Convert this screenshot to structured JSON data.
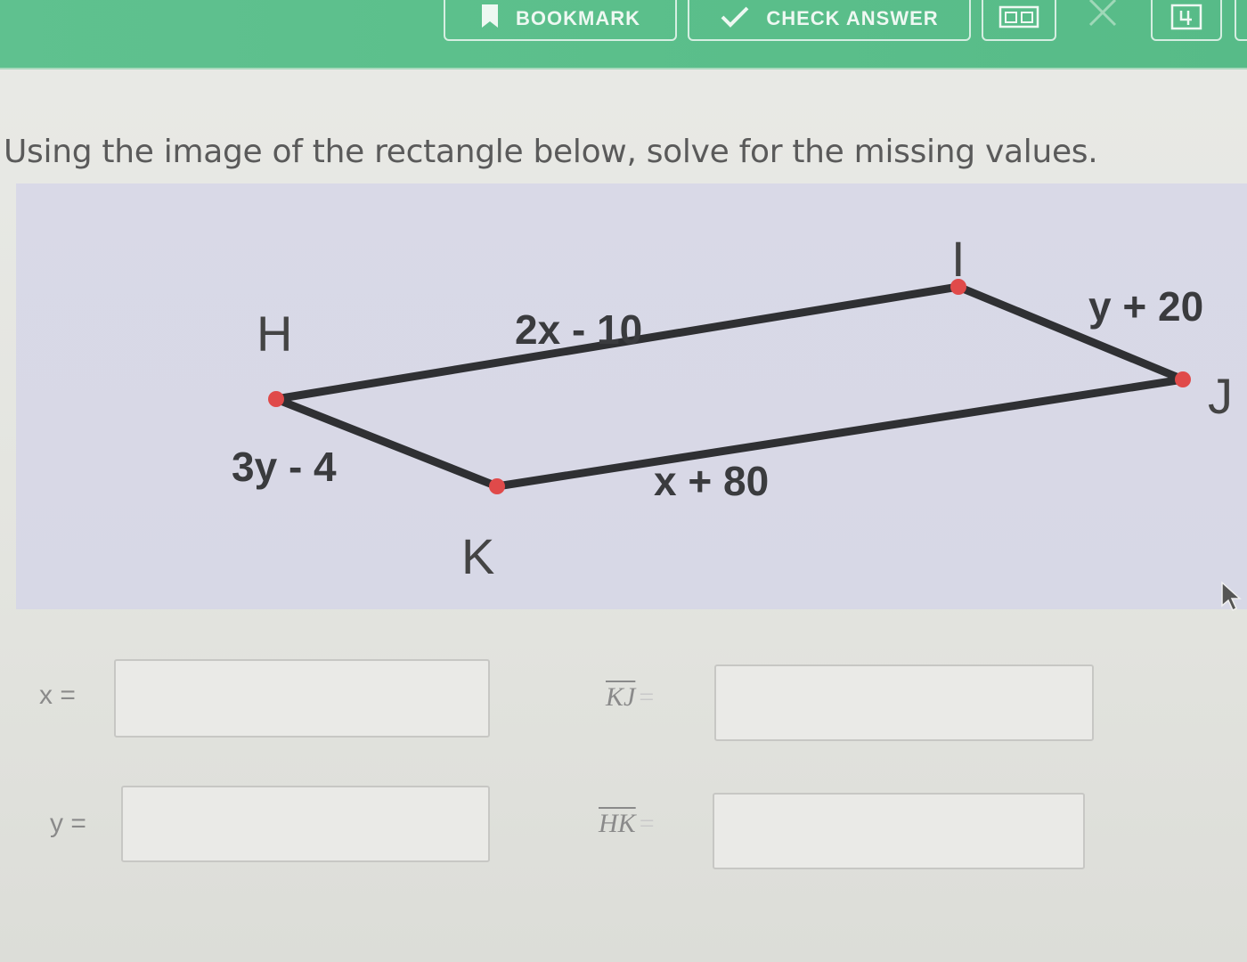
{
  "toolbar": {
    "bookmark_label": "BOOKMARK",
    "check_answer_label": "CHECK ANSWER",
    "icons": [
      "bookmark-icon",
      "checkmark-icon",
      "grid-icon",
      "close-icon",
      "external-link-icon"
    ]
  },
  "question": {
    "text": "Using the image of the rectangle below, solve for the missing values."
  },
  "figure": {
    "vertices": {
      "H": "H",
      "I": "I",
      "J": "J",
      "K": "K"
    },
    "side_labels": {
      "HI": "2x - 10",
      "IJ": "y + 20",
      "HK": "3y - 4",
      "KJ": "x + 80"
    },
    "colors": {
      "edge": "#2f3033",
      "vertex_dot": "#e04a4a"
    }
  },
  "answers": {
    "x": {
      "label": "x =",
      "value": ""
    },
    "y": {
      "label": "y =",
      "value": ""
    },
    "KJ": {
      "segment": "KJ",
      "equals": "=",
      "value": ""
    },
    "HK": {
      "segment": "HK",
      "equals": "=",
      "value": ""
    }
  }
}
